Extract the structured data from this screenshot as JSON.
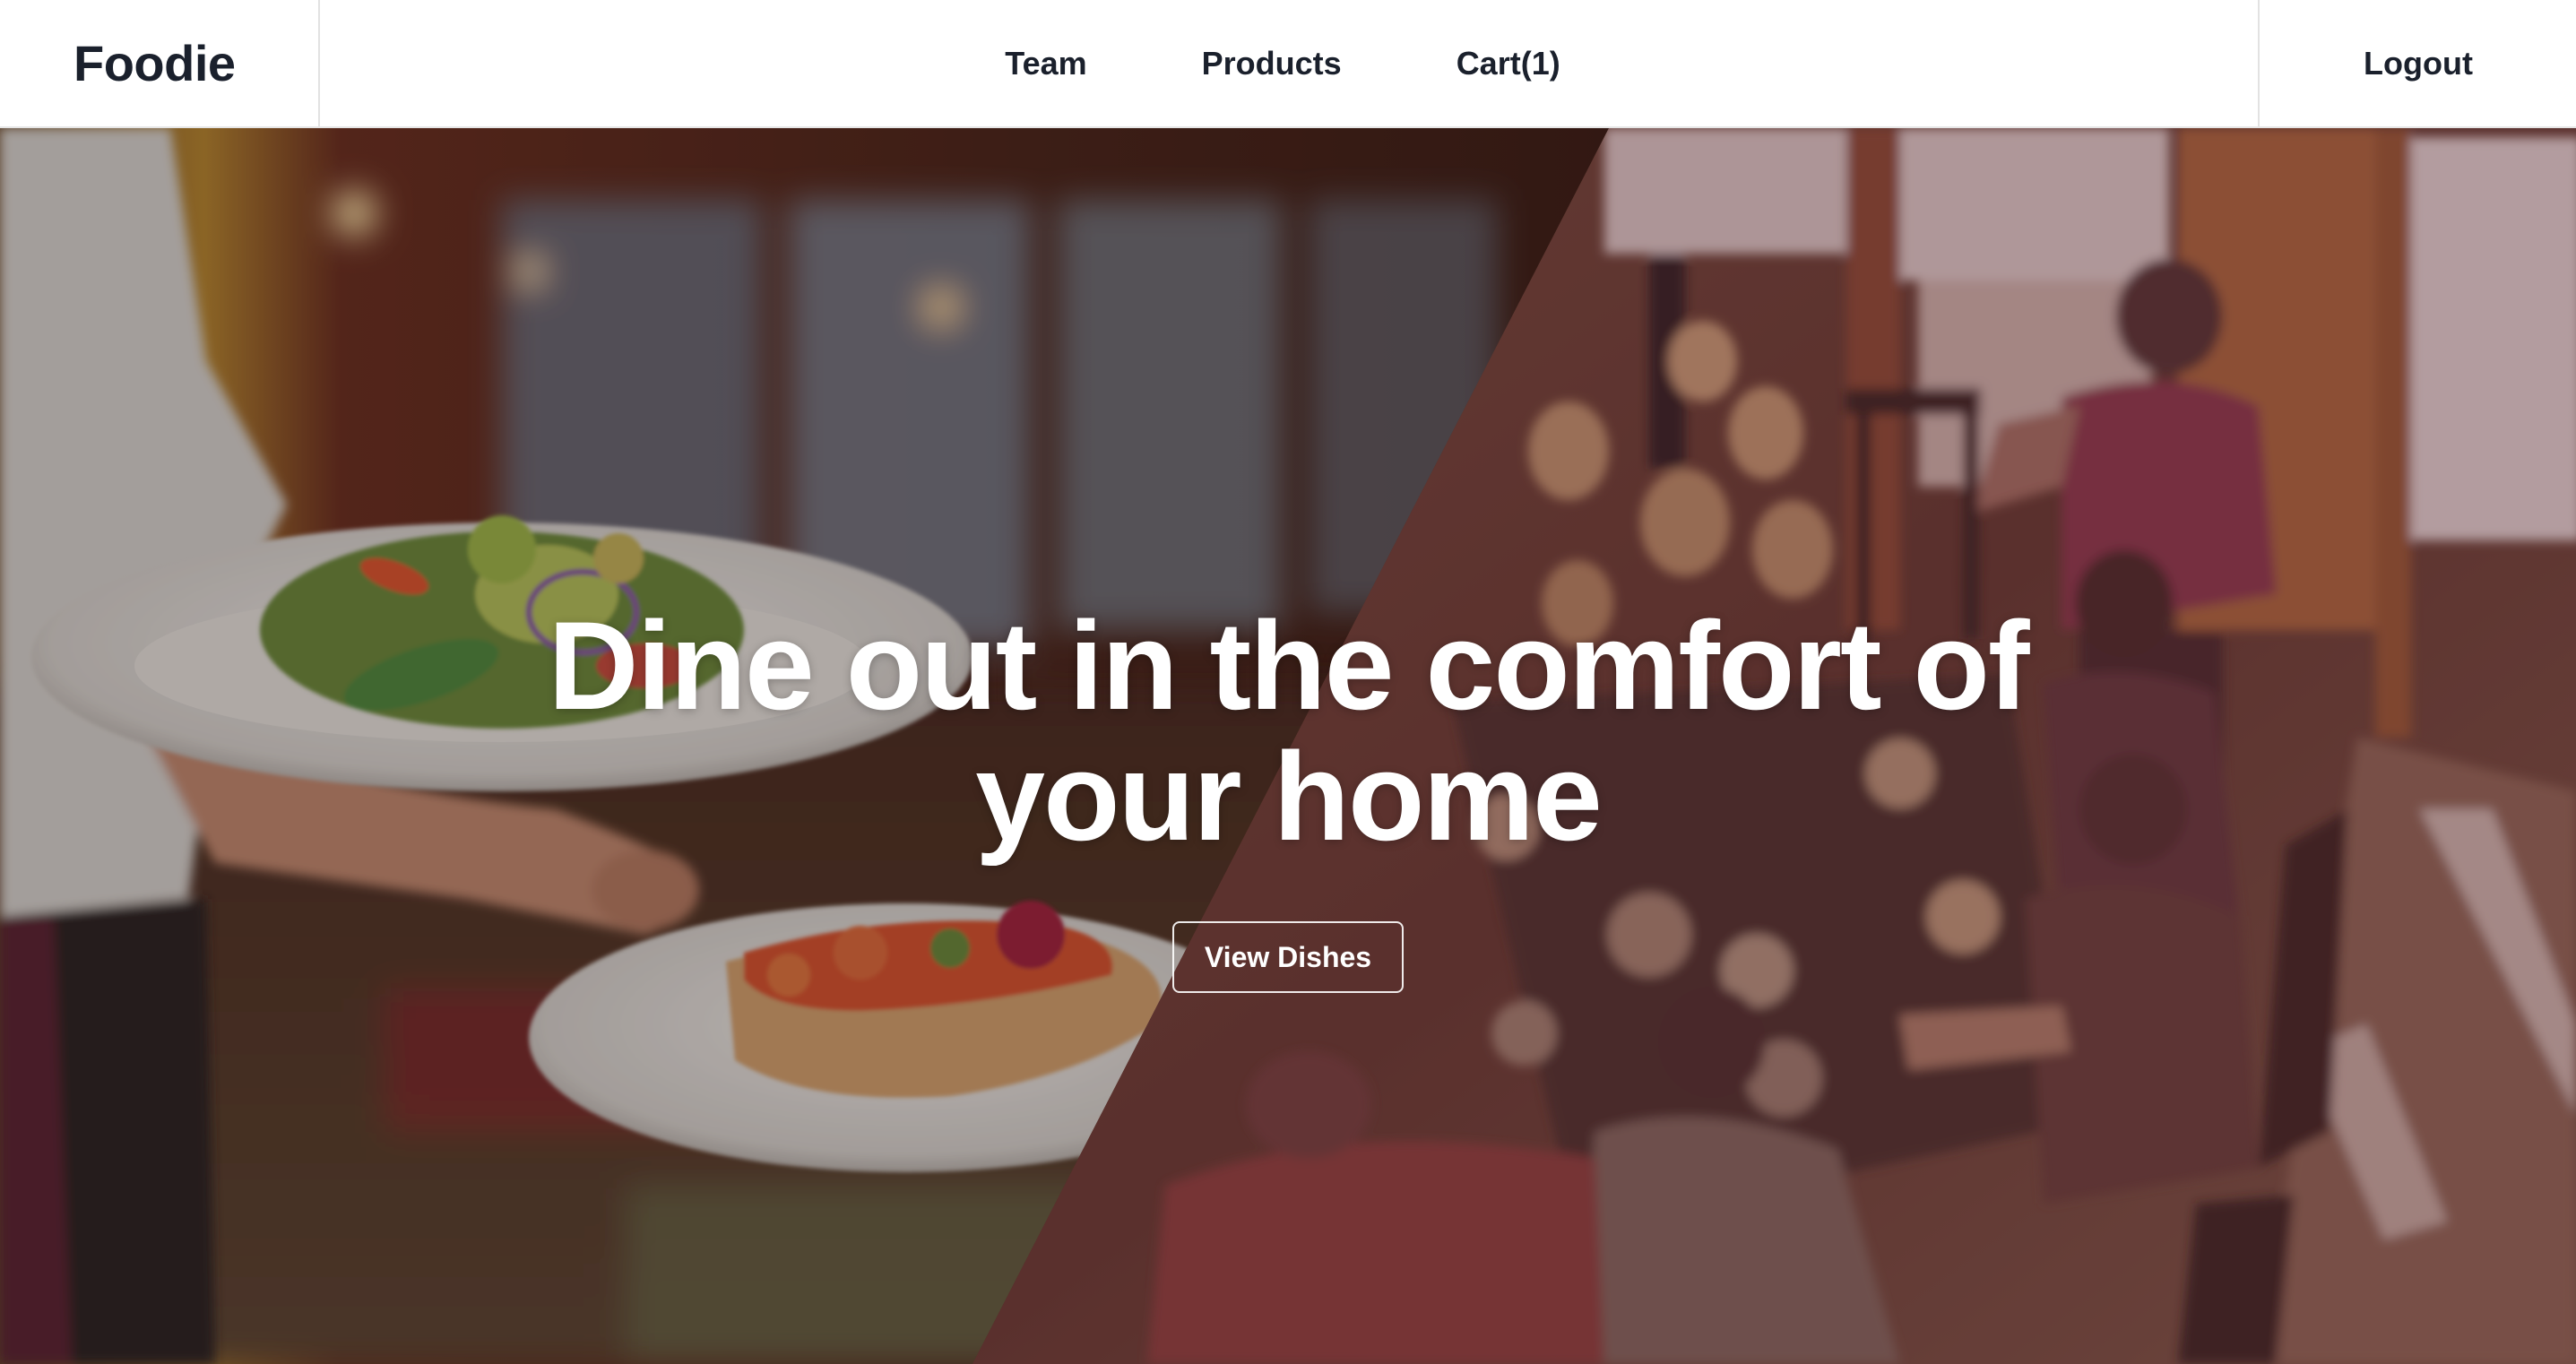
{
  "nav": {
    "brand": "Foodie",
    "links": [
      {
        "label": "Team"
      },
      {
        "label": "Products"
      },
      {
        "label": "Cart(1)"
      }
    ],
    "logout_label": "Logout"
  },
  "hero": {
    "headline": "Dine out in the comfort of your home",
    "cta_label": "View Dishes",
    "overlay_color": "#5a2a36"
  }
}
